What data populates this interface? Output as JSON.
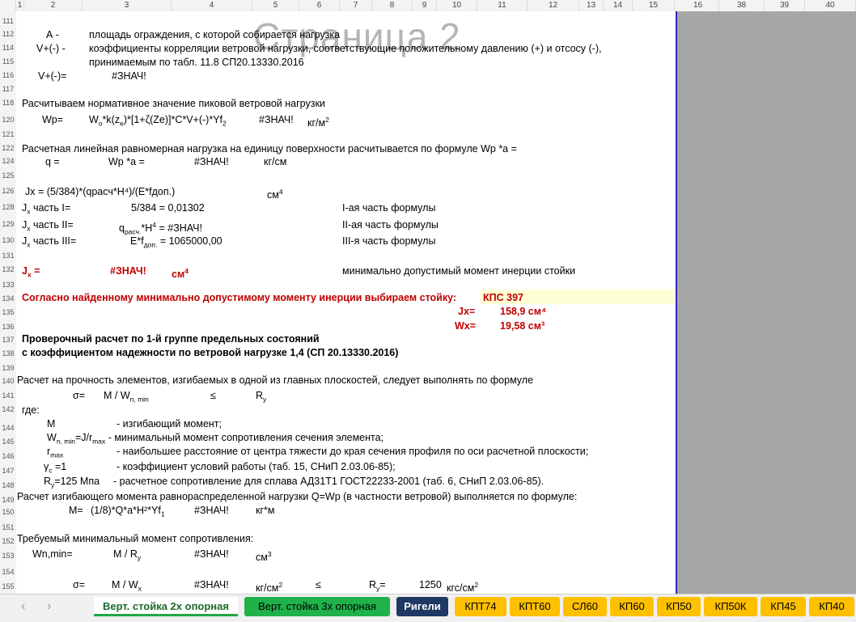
{
  "columns": [
    "1",
    "2",
    "3",
    "4",
    "5",
    "6",
    "7",
    "8",
    "9",
    "10",
    "11",
    "12",
    "13",
    "14",
    "15",
    "16",
    "38",
    "39",
    "40"
  ],
  "rows": [
    "111",
    "112",
    "114",
    "115",
    "116",
    "117",
    "118",
    "120",
    "121",
    "122",
    "124",
    "125",
    "126",
    "128",
    "129",
    "130",
    "131",
    "132",
    "133",
    "134",
    "135",
    "136",
    "137",
    "138",
    "139",
    "140",
    "141",
    "142",
    "143",
    "144",
    "145",
    "146",
    "147",
    "148",
    "149",
    "150",
    "151",
    "152",
    "153",
    "154",
    "155"
  ],
  "watermark": "Страница 2",
  "r112": {
    "a": "А  -",
    "b": "площадь ограждения, с которой собирается нагрузка"
  },
  "r114": {
    "a": "V+(-)  -",
    "b": "коэффициенты корреляции ветровой нагрузки, соответствующие положительному давлению (+) и отсосу (-),"
  },
  "r115": {
    "b": "принимаемым по табл. 11.8  СП20.13330.2016"
  },
  "r116": {
    "a": "V+(-)=",
    "b": "#ЗНАЧ!"
  },
  "r118": "Расчитываем нормативное значение пиковой ветровой нагрузки",
  "r120": {
    "a": "Wp=",
    "f1": "W",
    "f1s": "o",
    "f2": "*k(z",
    "f2s": "e",
    "f3": ")*[1+ζ(Ze)]*C*V+(-)*Yf",
    "f3s": "2",
    "v": "#ЗНАЧ!",
    "u": "кг/м",
    "usup": "2"
  },
  "r122": "Расчетная линейная равномерная нагрузка на единицу поверхности расчитывается по формуле Wp *a =",
  "r124": {
    "a": "q =",
    "f": "Wp *a =",
    "v": "#ЗНАЧ!",
    "u": "кг/см"
  },
  "r126": {
    "a": "Jx = (5/384)*(qрасч*H⁴)/(E*fдоп.)",
    "u": "см",
    "usup": "4"
  },
  "r128": {
    "a": "J",
    "as": "x",
    "a2": " часть I=",
    "f": "5/384 = 0,01302",
    "c": "I-ая часть формулы"
  },
  "r129": {
    "a": "J",
    "as": "x",
    "a2": " часть II=",
    "f": "q",
    "fs": "расч.",
    "f2": "*H",
    "f2sup": "4",
    "f3": " = #ЗНАЧ!",
    "c": "II-ая часть формулы"
  },
  "r130": {
    "a": "J",
    "as": "x",
    "a2": " часть III=",
    "f": "E*f",
    "fs": "доп.",
    "f3": " = 1065000,00",
    "c": "III-я часть формулы"
  },
  "r132": {
    "a": "J",
    "as": "x",
    "a2": " =",
    "v": "#ЗНАЧ!",
    "u": "см",
    "usup": "4",
    "c": "минимально допустимый момент инерции стойки"
  },
  "r134": {
    "a": "Согласно найденному минимально допустимому моменту инерции выбираем стойку:",
    "v": "КПС 397"
  },
  "r135": {
    "a": "Jx=",
    "v": "158,9 см⁴"
  },
  "r136": {
    "a": "Wx=",
    "v": "19,58 см³"
  },
  "r137": "Проверочный расчет по 1-й группе предельных состояний",
  "r138": "с коэффициентом надежности по ветровой нагрузке 1,4 (СП 20.13330.2016)",
  "r140": "Расчет на прочность элементов, изгибаемых в одной из главных плоскостей, следует выполнять по формуле",
  "r141": {
    "a": "σ=",
    "f": "M / W",
    "fs": "n, min",
    "le": "≤",
    "r": "R",
    "rs": "y"
  },
  "r143": "где:",
  "r144": {
    "a": "M",
    "b": "- изгибающий момент;"
  },
  "r145": {
    "a": "W",
    "as": "n, min",
    "a2": "=J/r",
    "a2s": "max",
    "b": " - минимальный момент сопротивления сечения элемента;"
  },
  "r146": {
    "a": "r",
    "as": "max",
    "b": "- наибольшее расстояние от центра тяжести до края сечения профиля по оси расчетной плоскости;"
  },
  "r147": {
    "a": "γ",
    "as": "c",
    "a2": " =1",
    "b": "- коэффициент условий работы (таб. 15, СНиП 2.03.06-85);"
  },
  "r148": {
    "a": "R",
    "as": "y",
    "a2": "=125 Мпа",
    "b": "- расчетное сопротивление для сплава АД31Т1 ГОСТ22233-2001 (таб. 6, СНиП 2.03.06-85)."
  },
  "r149": "Расчет изгибающего момента равнораспределенной нагрузки Q=Wp (в частности ветровой) выполняется по формуле:",
  "r150": {
    "a": "M=",
    "f": "(1/8)*Q*a*H²*Yf",
    "fs": "1",
    "v": "#ЗНАЧ!",
    "u": "кг*м"
  },
  "r152": "Требуемый минимальный момент сопротивления:",
  "r153": {
    "a": "Wn,min=",
    "f": "M / R",
    "fs": "y",
    "v": "#ЗНАЧ!",
    "u": "см",
    "usup": "3"
  },
  "r155": {
    "a": "σ=",
    "f": "M / W",
    "fs": "x",
    "v": "#ЗНАЧ!",
    "u": "кг/см",
    "usup": "2",
    "le": "≤",
    "r": "R",
    "rs": "y",
    "r2": "=",
    "rv": "1250",
    "ru": "кгс/см",
    "rusup": "2"
  },
  "tabs": {
    "prev": "‹",
    "next": "›",
    "t1": "Верт. стойка 2х опорная",
    "t2": "Верт. стойка 3х опорная",
    "t3": "Ригели",
    "t4": "КПТ74",
    "t5": "КПТ60",
    "t6": "СЛ60",
    "t7": "КП60",
    "t8": "КП50",
    "t9": "КП50К",
    "t10": "КП45",
    "t11": "КП40"
  },
  "colors": {
    "red": "#c00000",
    "tab_green": "#1fb24a",
    "tab_navy": "#1f3864",
    "tab_yellow": "#ffc000",
    "page_border": "#2b2bb8"
  }
}
